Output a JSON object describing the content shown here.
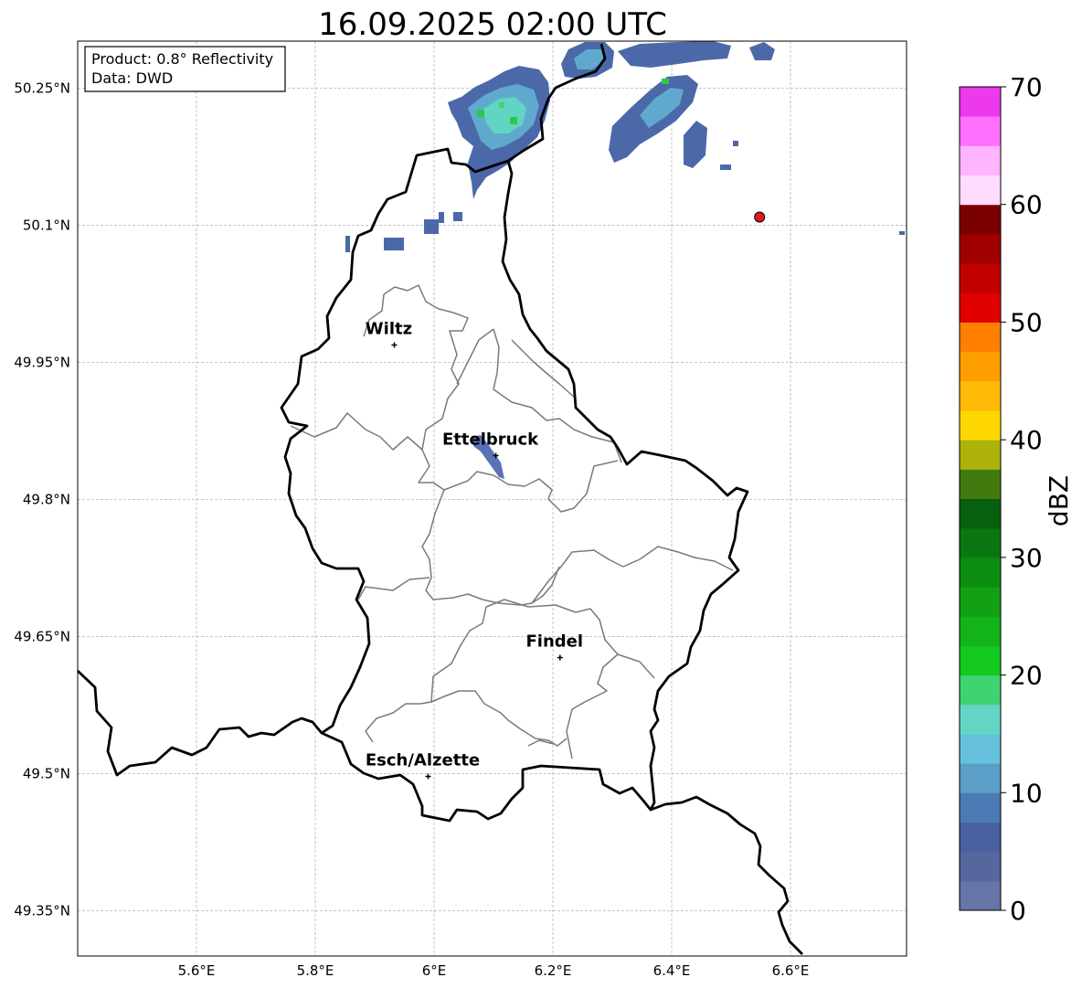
{
  "title": "16.09.2025 02:00 UTC",
  "info_box": {
    "line1": "Product: 0.8° Reflectivity",
    "line2": "Data: DWD"
  },
  "lat_labels": [
    {
      "value": 50.25,
      "text": "50.25°N"
    },
    {
      "value": 50.1,
      "text": "50.1°N"
    },
    {
      "value": 49.95,
      "text": "49.95°N"
    },
    {
      "value": 49.8,
      "text": "49.8°N"
    },
    {
      "value": 49.65,
      "text": "49.65°N"
    },
    {
      "value": 49.5,
      "text": "49.5°N"
    },
    {
      "value": 49.35,
      "text": "49.35°N"
    }
  ],
  "lon_labels": [
    {
      "value": 5.6,
      "text": "5.6°E"
    },
    {
      "value": 5.8,
      "text": "5.8°E"
    },
    {
      "value": 6.0,
      "text": "6°E"
    },
    {
      "value": 6.2,
      "text": "6.2°E"
    },
    {
      "value": 6.4,
      "text": "6.4°E"
    },
    {
      "value": 6.6,
      "text": "6.6°E"
    }
  ],
  "cities": [
    {
      "name": "Wiltz",
      "lon": 5.933,
      "lat": 49.969
    },
    {
      "name": "Ettelbruck",
      "lon": 6.104,
      "lat": 49.848
    },
    {
      "name": "Findel",
      "lon": 6.212,
      "lat": 49.627
    },
    {
      "name": "Esch/Alzette",
      "lon": 5.99,
      "lat": 49.497
    }
  ],
  "radar_site": {
    "lon": 6.548,
    "lat": 50.109,
    "color": "#e31a1c"
  },
  "colorbar": {
    "label": "dBZ",
    "min": 0,
    "max": 70,
    "step": 2.5,
    "ticks": [
      "0",
      "10",
      "20",
      "30",
      "40",
      "50",
      "60",
      "70"
    ],
    "colors": [
      "#6674a8",
      "#56679e",
      "#4a619f",
      "#4b7bb4",
      "#5b9ec8",
      "#66c1dc",
      "#65d6c5",
      "#3fd371",
      "#13c81f",
      "#12b419",
      "#11a112",
      "#0d8d10",
      "#0a7711",
      "#07600e",
      "#437a10",
      "#adb30b",
      "#ffd700",
      "#ffb907",
      "#ff9e00",
      "#ff8000",
      "#e00000",
      "#c10000",
      "#a00000",
      "#7b0000",
      "#ffdcff",
      "#ffb4ff",
      "#ff70ff",
      "#eb39eb"
    ]
  }
}
